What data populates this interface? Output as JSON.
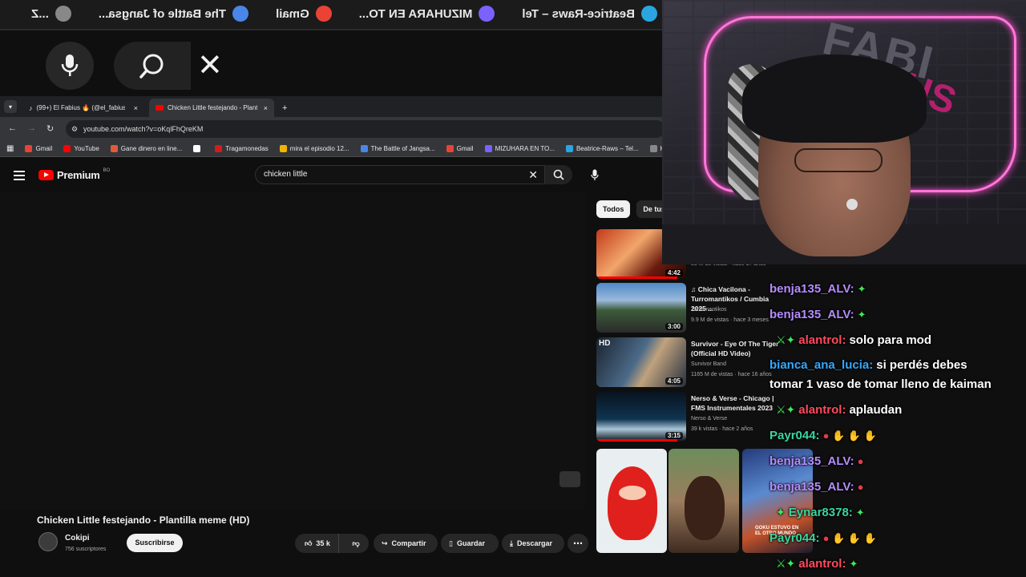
{
  "top_bar": {
    "items": [
      "Beatrice-Raws – Tel",
      "MIZUHARA EN TO...",
      "Gmail",
      "The Battle of Jangsa...",
      "...Z"
    ]
  },
  "voice_search": {
    "close_symbol": "✕"
  },
  "browser": {
    "tabs": [
      {
        "label": "(99+) El Fabius 🔥 (@el_fabius",
        "close": "×"
      },
      {
        "label": "Chicken Little festejando - Plantil",
        "close": "×"
      }
    ],
    "new_tab": "+",
    "url": "youtube.com/watch?v=oKqlFhQreKM",
    "bookmarks": [
      {
        "label": "Gmail",
        "color": "#ea4335"
      },
      {
        "label": "YouTube",
        "color": "#ff0000"
      },
      {
        "label": "Gane dinero en line...",
        "color": "#e05a3a"
      },
      {
        "label": "",
        "color": "#ffffff"
      },
      {
        "label": "Tragamonedas",
        "color": "#d61b1b"
      },
      {
        "label": "mira el episodio 12...",
        "color": "#f0b400"
      },
      {
        "label": "The Battle of Jangsa...",
        "color": "#4a86e8"
      },
      {
        "label": "Gmail",
        "color": "#ea4335"
      },
      {
        "label": "MIZUHARA EN TO...",
        "color": "#7b61ff"
      },
      {
        "label": "Beatrice-Raws – Tel...",
        "color": "#2aa5e0"
      },
      {
        "label": "Ka",
        "color": "#888888"
      }
    ]
  },
  "youtube": {
    "logo_text": "Premium",
    "logo_region": "BO",
    "search_value": "chicken little",
    "clear_symbol": "✕",
    "video": {
      "title": "Chicken Little festejando - Plantilla meme (HD)",
      "channel": "Cokipi",
      "subscribers": "756 suscriptores",
      "subscribe_label": "Suscribirse",
      "likes": "35 k",
      "share_label": "Compartir",
      "save_label": "Guardar",
      "download_label": "Descargar",
      "more_symbol": "⋯"
    },
    "filters": [
      "Todos",
      "De tus"
    ],
    "recommendations": [
      {
        "title": "",
        "channel": "",
        "views": "35 M de vistas · hace 17 años",
        "duration": "4:42",
        "progress": 0.9
      },
      {
        "title": "♫ Chica Vacilona - Turromantikos / Cumbia 2025 ...",
        "channel": "Turromantikos",
        "views": "9.9 M de vistas · hace 3 meses",
        "duration": "3:00",
        "progress": 0
      },
      {
        "title": "Survivor - Eye Of The Tiger (Official HD Video)",
        "channel": "Survivor Band",
        "views": "1165 M de vistas · hace 16 años",
        "duration": "4:05",
        "progress": 0
      },
      {
        "title": "Nerso & Verse - Chicago | FMS Instrumentales 2023",
        "channel": "Nerso & Verse",
        "views": "39 k vistas · hace 2 años",
        "duration": "3:15",
        "progress": 0.9
      }
    ],
    "shorts_caption": "GOKU ESTUVO EN EL OTRO MUNDO"
  },
  "chat": {
    "messages": [
      {
        "user": "benja135_ALV:",
        "color": "#b58cff",
        "text": "",
        "badges": "",
        "emotes": "✦"
      },
      {
        "user": "benja135_ALV:",
        "color": "#b58cff",
        "text": "",
        "badges": "",
        "emotes": "✦"
      },
      {
        "user": "alantrol:",
        "color": "#ff4a5e",
        "text": "solo para mod",
        "badges": "⚔✦",
        "emotes": ""
      },
      {
        "user": "bianca_ana_lucia:",
        "color": "#35a9ff",
        "text": "si perdés debes",
        "badges": "",
        "emotes": ""
      },
      {
        "user": "",
        "color": "#ffffff",
        "text": "tomar 1 vaso de tomar lleno de kaiman",
        "badges": "",
        "emotes": ""
      },
      {
        "user": "alantrol:",
        "color": "#ff4a5e",
        "text": "aplaudan",
        "badges": "⚔✦",
        "emotes": ""
      },
      {
        "user": "Payr044:",
        "color": "#3ad6a0",
        "text": "",
        "badges": "",
        "emotes": "● ✋ ✋ ✋"
      },
      {
        "user": "benja135_ALV:",
        "color": "#b58cff",
        "text": "",
        "badges": "",
        "emotes": "●"
      },
      {
        "user": "benja135_ALV:",
        "color": "#b58cff",
        "text": "",
        "badges": "",
        "emotes": "●"
      },
      {
        "user": "Eynar8378:",
        "color": "#3ad6a0",
        "text": "",
        "badges": "✦",
        "emotes": "✦"
      },
      {
        "user": "Payr044:",
        "color": "#3ad6a0",
        "text": "",
        "badges": "",
        "emotes": "● ✋ ✋ ✋"
      },
      {
        "user": "alantrol:",
        "color": "#ff4a5e",
        "text": "",
        "badges": "⚔✦",
        "emotes": "✦"
      }
    ]
  },
  "colors": {
    "accent": "#ff0000",
    "neon": "#ff77d9",
    "chat_emote_green": "#3ee85a"
  }
}
